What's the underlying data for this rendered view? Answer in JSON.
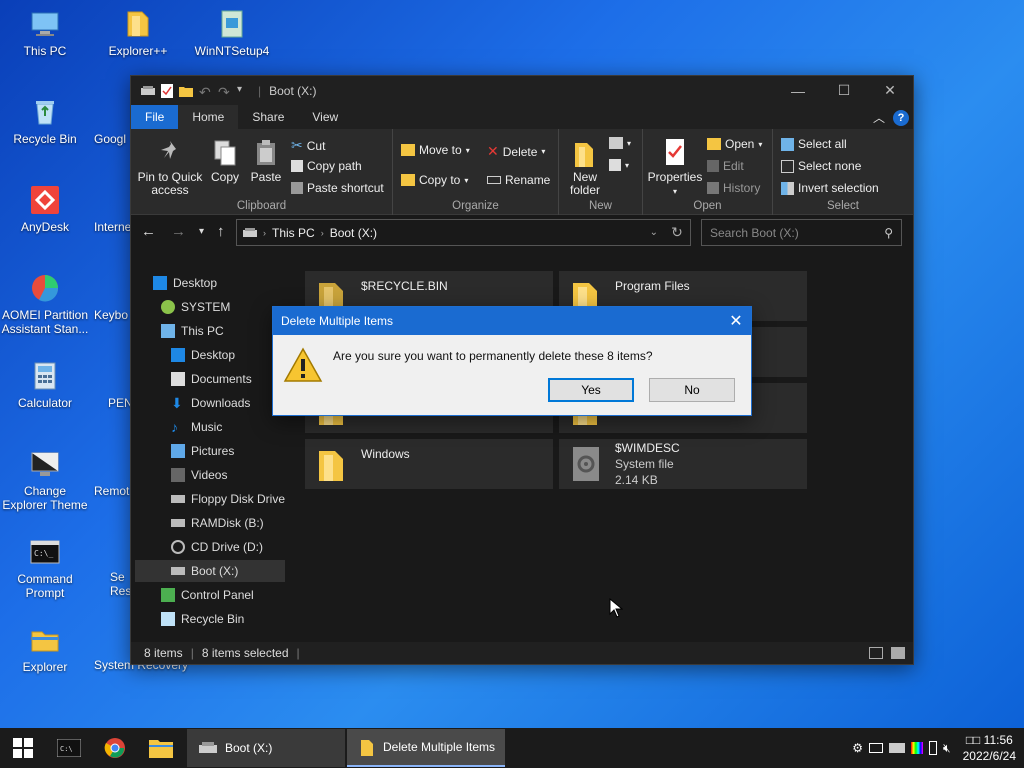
{
  "desktop": {
    "icons": [
      {
        "label": "This PC"
      },
      {
        "label": "Explorer++"
      },
      {
        "label": "WinNTSetup4"
      },
      {
        "label": "Recycle Bin"
      },
      {
        "label": "Googl"
      },
      {
        "label": "AnyDesk"
      },
      {
        "label": "Interne"
      },
      {
        "label": "AOMEI Partition Assistant Stan..."
      },
      {
        "label": "Keybo"
      },
      {
        "label": "Calculator"
      },
      {
        "label": "PEN"
      },
      {
        "label": "Change Explorer Theme"
      },
      {
        "label": "Remot"
      },
      {
        "label": "Command Prompt"
      },
      {
        "label": "Se Res"
      },
      {
        "label": "Explorer"
      },
      {
        "label": "System Recovery"
      }
    ]
  },
  "explorer": {
    "title": "Boot (X:)",
    "tabs": [
      "File",
      "Home",
      "Share",
      "View"
    ],
    "ribbon": {
      "clipboard": {
        "pin": "Pin to Quick access",
        "copy": "Copy",
        "paste": "Paste",
        "cut": "Cut",
        "copy_path": "Copy path",
        "paste_shortcut": "Paste shortcut",
        "label": "Clipboard"
      },
      "organize": {
        "move_to": "Move to",
        "copy_to": "Copy to",
        "delete": "Delete",
        "rename": "Rename",
        "label": "Organize"
      },
      "new": {
        "new_folder": "New folder",
        "label": "New"
      },
      "open": {
        "properties": "Properties",
        "open": "Open",
        "edit": "Edit",
        "history": "History",
        "label": "Open"
      },
      "select": {
        "select_all": "Select all",
        "select_none": "Select none",
        "invert": "Invert selection",
        "label": "Select"
      }
    },
    "address": {
      "crumbs": [
        "This PC",
        "Boot (X:)"
      ],
      "search_placeholder": "Search Boot (X:)"
    },
    "nav": [
      {
        "label": "Desktop"
      },
      {
        "label": "SYSTEM"
      },
      {
        "label": "This PC"
      },
      {
        "label": "Desktop"
      },
      {
        "label": "Documents"
      },
      {
        "label": "Downloads"
      },
      {
        "label": "Music"
      },
      {
        "label": "Pictures"
      },
      {
        "label": "Videos"
      },
      {
        "label": "Floppy Disk Drive"
      },
      {
        "label": "RAMDisk (B:)"
      },
      {
        "label": "CD Drive (D:)"
      },
      {
        "label": "Boot (X:)"
      },
      {
        "label": "Control Panel"
      },
      {
        "label": "Recycle Bin"
      }
    ],
    "files": [
      {
        "name": "$RECYCLE.BIN"
      },
      {
        "name": "Program Files"
      },
      {
        "name": "Windows"
      },
      {
        "name": "$WIMDESC",
        "type": "System file",
        "size": "2.14 KB"
      }
    ],
    "status": {
      "count": "8 items",
      "selected": "8 items selected"
    }
  },
  "dialog": {
    "title": "Delete Multiple Items",
    "message": "Are you sure you want to permanently delete these 8 items?",
    "yes": "Yes",
    "no": "No"
  },
  "taskbar": {
    "tasks": [
      {
        "label": "Boot (X:)"
      },
      {
        "label": "Delete Multiple Items"
      }
    ],
    "clock": {
      "time": "11:56",
      "time_prefix": "□□",
      "date": "2022/6/24"
    }
  }
}
